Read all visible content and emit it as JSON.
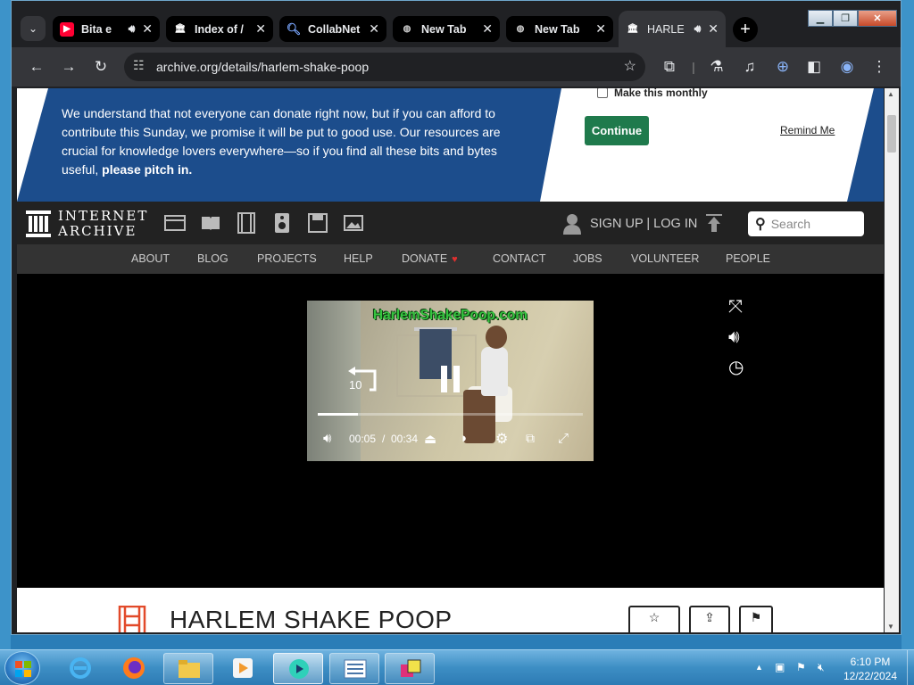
{
  "browser": {
    "tabs": [
      {
        "title": "Bita e",
        "icon": "youtube-icon",
        "has_audio": true
      },
      {
        "title": "Index of /",
        "icon": "archive-icon",
        "has_audio": false
      },
      {
        "title": "CollabNet",
        "icon": "search-magnifier-icon",
        "has_audio": false
      },
      {
        "title": "New Tab",
        "icon": "globe-icon",
        "has_audio": false
      },
      {
        "title": "New Tab",
        "icon": "globe-icon",
        "has_audio": false
      },
      {
        "title": "HARLE",
        "icon": "archive-icon",
        "has_audio": true,
        "active": true
      }
    ],
    "url": "archive.org/details/harlem-shake-poop"
  },
  "donation_banner": {
    "text": "We understand that not everyone can donate right now, but if you can afford to contribute this Sunday, we promise it will be put to good use. Our resources are crucial for knowledge lovers everywhere—so if you find all these bits and bytes useful, ",
    "bold_text": "please pitch in.",
    "monthly_label": "Make this monthly",
    "continue_label": "Continue",
    "remind_label": "Remind Me"
  },
  "ia_header": {
    "logo_line1": "INTERNET",
    "logo_line2": "ARCHIVE",
    "signup_label": "SIGN UP | LOG IN",
    "search_placeholder": "Search"
  },
  "nav": {
    "items": [
      "ABOUT",
      "BLOG",
      "PROJECTS",
      "HELP",
      "DONATE",
      "CONTACT",
      "JOBS",
      "VOLUNTEER",
      "PEOPLE"
    ]
  },
  "player": {
    "watermark": "HarlemShakePoop.com",
    "replay_seconds": "10",
    "current_time": "00:05",
    "separator": "/",
    "duration": "00:34",
    "progress_fraction": 0.15
  },
  "item": {
    "title": "HARLEM SHAKE POOP"
  },
  "taskbar": {
    "time": "6:10 PM",
    "date": "12/22/2024"
  },
  "colors": {
    "banner_blue": "#1c4d8c",
    "continue_green": "#1f7a4c",
    "donate_heart": "#e0302f",
    "watermark_green": "#35c43f"
  }
}
